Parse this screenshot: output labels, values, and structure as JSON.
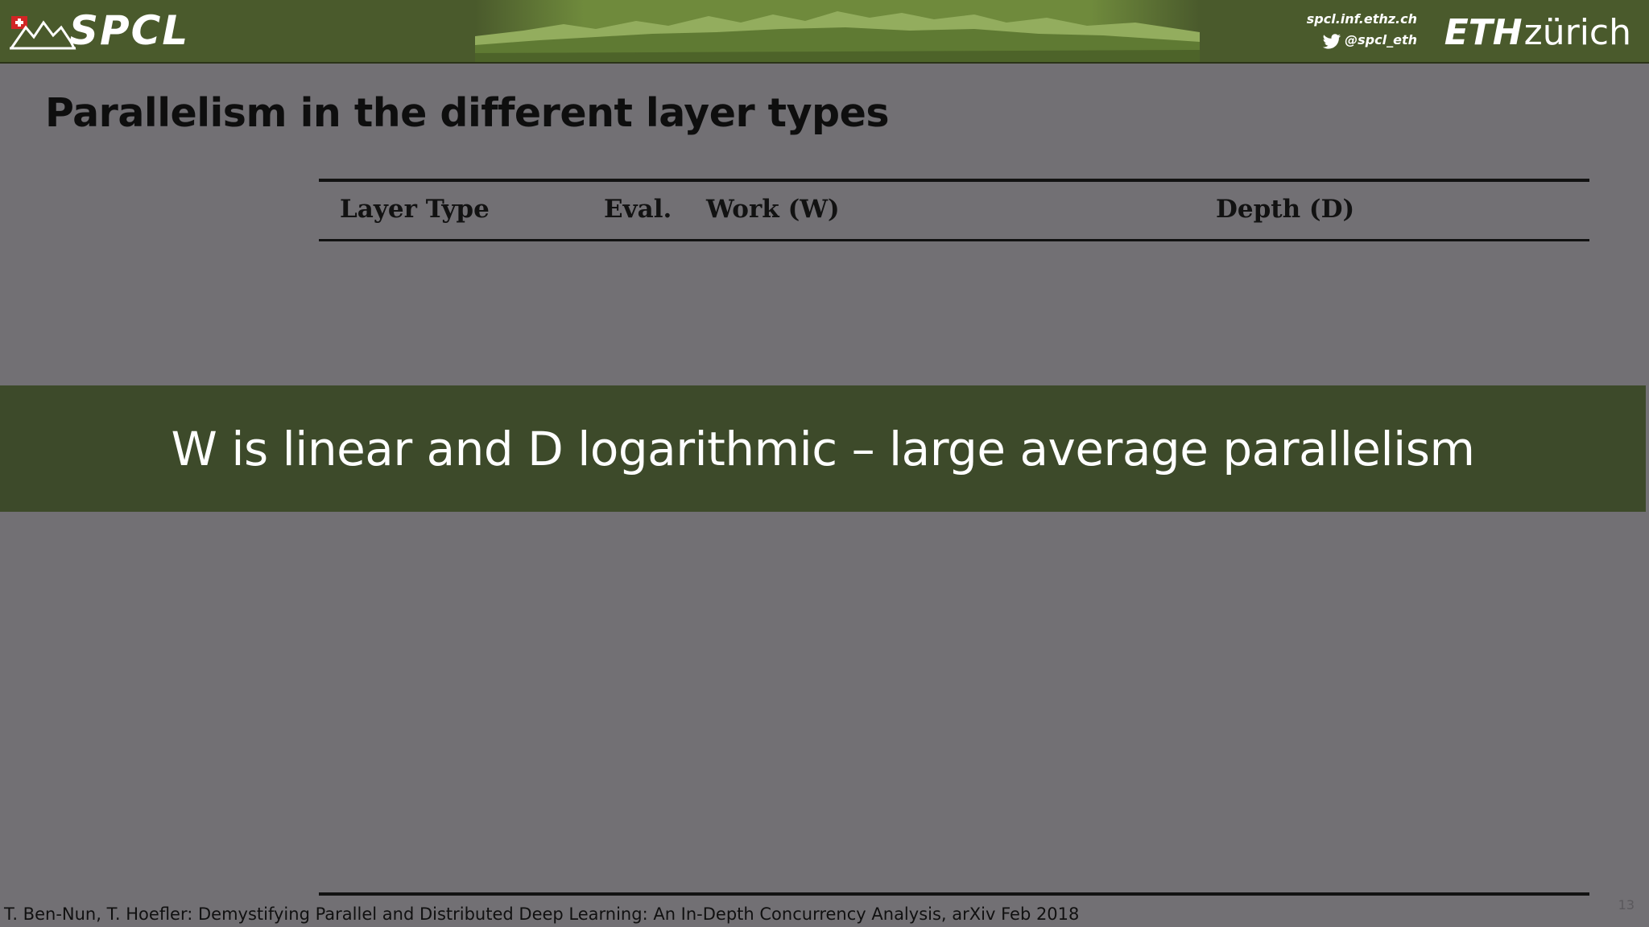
{
  "header": {
    "logo_text": "SPCL",
    "site": "spcl.inf.ethz.ch",
    "twitter": "@spcl_eth",
    "institution_bold": "ETH",
    "institution_light": "zürich"
  },
  "slide": {
    "title": "Parallelism in the different layer types",
    "table": {
      "columns": [
        "Layer Type",
        "Eval.",
        "Work (W)",
        "Depth (D)"
      ]
    },
    "banner": "W is linear and D logarithmic – large average parallelism",
    "citation": "T. Ben-Nun, T. Hoefler: Demystifying Parallel and Distributed Deep Learning: An In-Depth Concurrency Analysis, arXiv Feb 2018",
    "page_number": "13"
  },
  "colors": {
    "header_green": "#4a5a2c",
    "banner_green": "#3d4a2a",
    "slide_gray": "#727074"
  },
  "icons": {
    "spcl": "mountain-logo-icon",
    "twitter": "twitter-bird-icon",
    "swiss_flag": "swiss-flag-icon"
  }
}
